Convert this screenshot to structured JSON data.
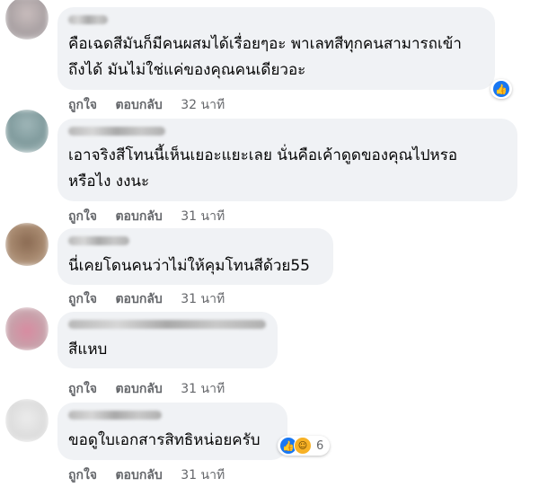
{
  "comments": [
    {
      "lines": [
        "คือเฉดสีมันก็มีคนผสมได้เรื่อยๆอะ พาเลทสีทุกคนสามารถเข้า",
        "ถึงได้ มันไม่ใช่แค่ของคุณคนเดียวอะ"
      ],
      "like_label": "ถูกใจ",
      "reply_label": "ตอบกลับ",
      "time": "32 นาที",
      "reaction": {
        "icons": [
          "like-icon"
        ],
        "count": ""
      }
    },
    {
      "lines": [
        "เอาจริงสีโทนนี้เห็นเยอะแยะเลย นั่นคือเค้าดูดของคุณไปหรอ",
        "หรือไง งงนะ"
      ],
      "like_label": "ถูกใจ",
      "reply_label": "ตอบกลับ",
      "time": "31 นาที"
    },
    {
      "lines": [
        "นี่เคยโดนคนว่าไม่ให้คุมโทนสีด้วย55"
      ],
      "like_label": "ถูกใจ",
      "reply_label": "ตอบกลับ",
      "time": "31 นาที"
    },
    {
      "lines": [
        "สีแหบ"
      ],
      "like_label": "ถูกใจ",
      "reply_label": "ตอบกลับ",
      "time": "31 นาที"
    },
    {
      "lines": [
        "ขอดูใบเอกสารสิทธิหน่อยครับ"
      ],
      "like_label": "ถูกใจ",
      "reply_label": "ตอบกลับ",
      "time": "31 นาที",
      "reaction": {
        "icons": [
          "like-icon",
          "haha-icon"
        ],
        "count": "6"
      }
    }
  ],
  "colors": {
    "bubble": "#f0f2f5",
    "action_text": "#65676b",
    "like_blue": "#1877f2",
    "haha_yellow": "#f7b125"
  }
}
